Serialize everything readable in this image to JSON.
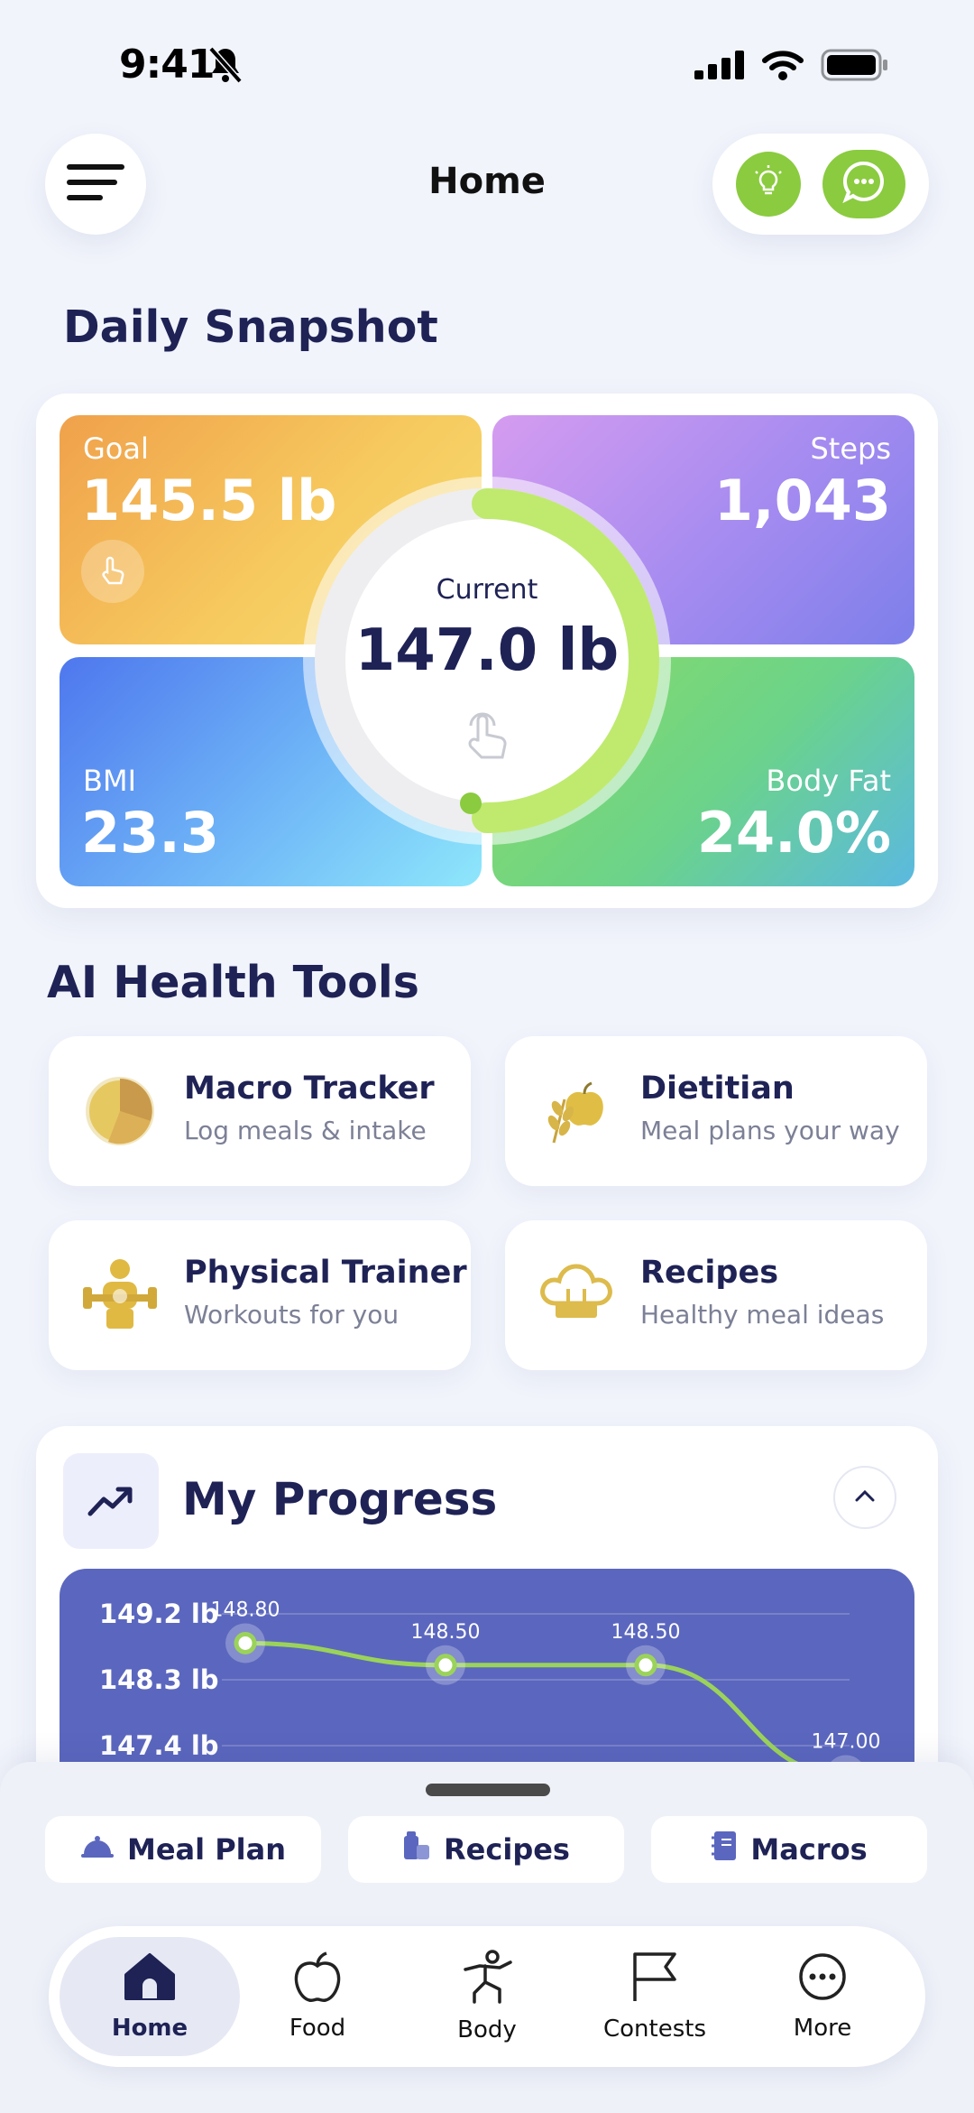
{
  "status": {
    "time": "9:41"
  },
  "header": {
    "title": "Home"
  },
  "snapshot": {
    "section_title": "Daily Snapshot",
    "goal": {
      "label": "Goal",
      "value": "145.5 lb"
    },
    "steps": {
      "label": "Steps",
      "value": "1,043"
    },
    "bmi": {
      "label": "BMI",
      "value": "23.3"
    },
    "body_fat": {
      "label": "Body Fat",
      "value": "24.0%"
    },
    "current": {
      "label": "Current",
      "value": "147.0 lb"
    }
  },
  "tools": {
    "section_title": "AI Health Tools",
    "items": [
      {
        "title": "Macro Tracker",
        "subtitle": "Log meals & intake",
        "icon": "pie-chart-icon"
      },
      {
        "title": "Dietitian",
        "subtitle": "Meal plans your way",
        "icon": "apple-wheat-icon"
      },
      {
        "title": "Physical Trainer",
        "subtitle": "Workouts for you",
        "icon": "trainer-icon"
      },
      {
        "title": "Recipes",
        "subtitle": "Healthy meal ideas",
        "icon": "chef-hat-icon"
      }
    ]
  },
  "progress": {
    "title": "My Progress",
    "y_ticks": [
      "149.2 lb",
      "148.3 lb",
      "147.4 lb"
    ],
    "point_labels": [
      "148.80",
      "148.50",
      "148.50",
      "147.00"
    ]
  },
  "chart_data": {
    "type": "line",
    "y_tick_labels": [
      "149.2 lb",
      "148.3 lb",
      "147.4 lb"
    ],
    "y_ticks": [
      149.2,
      148.3,
      147.4
    ],
    "values": [
      148.8,
      148.5,
      148.5,
      147.0
    ],
    "data_labels": [
      "148.80",
      "148.50",
      "148.50",
      "147.00"
    ],
    "grid": true,
    "line_color": "#9BD35A"
  },
  "quick_actions": [
    {
      "label": "Meal Plan",
      "icon": "cloche-icon"
    },
    {
      "label": "Recipes",
      "icon": "grocery-icon"
    },
    {
      "label": "Macros",
      "icon": "notebook-icon"
    }
  ],
  "tabs": [
    {
      "label": "Home",
      "icon": "home-icon",
      "active": true
    },
    {
      "label": "Food",
      "icon": "apple-icon"
    },
    {
      "label": "Body",
      "icon": "body-icon"
    },
    {
      "label": "Contests",
      "icon": "flag-icon"
    },
    {
      "label": "More",
      "icon": "more-icon"
    }
  ],
  "colors": {
    "accent_green": "#8BCB3F",
    "navy": "#1E2255",
    "chart_bg": "#5B67BE"
  }
}
